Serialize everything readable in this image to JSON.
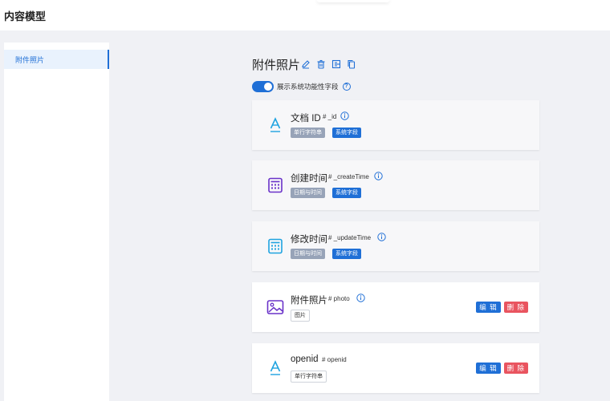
{
  "header": {
    "title": "内容模型"
  },
  "sidebar": {
    "items": [
      {
        "label": "附件照片",
        "active": true
      }
    ]
  },
  "model": {
    "title": "附件照片",
    "toolbar_icons": [
      "edit-icon",
      "trash-icon",
      "export-icon",
      "copy-icon"
    ],
    "toggle": {
      "label": "展示系统功能性字段",
      "on": true
    }
  },
  "fields": [
    {
      "name": "文档 ID",
      "id": "# _id",
      "icon": "text-a-icon",
      "tags": [
        "单行字符串",
        "系统字段"
      ],
      "system": true
    },
    {
      "name": "创建时间",
      "id": "# _createTime",
      "icon": "calendar-icon",
      "tags": [
        "日期与时间",
        "系统字段"
      ],
      "system": true
    },
    {
      "name": "修改时间",
      "id": "# _updateTime",
      "icon": "calendar-icon",
      "tags": [
        "日期与时间",
        "系统字段"
      ],
      "system": true
    },
    {
      "name": "附件照片",
      "id": "# photo",
      "icon": "image-icon",
      "tags": [
        "图片"
      ],
      "system": false
    },
    {
      "name": "openid",
      "id": "# openid",
      "icon": "text-a-icon",
      "tags": [
        "单行字符串"
      ],
      "system": false
    }
  ],
  "actions": {
    "edit_label": "编 辑",
    "delete_label": "删 除"
  },
  "colors": {
    "primary": "#1f6fd6",
    "danger": "#e9545f",
    "tag_gray": "#97a3b8",
    "purple": "#6a32c9",
    "cyan": "#1fa3e0"
  }
}
